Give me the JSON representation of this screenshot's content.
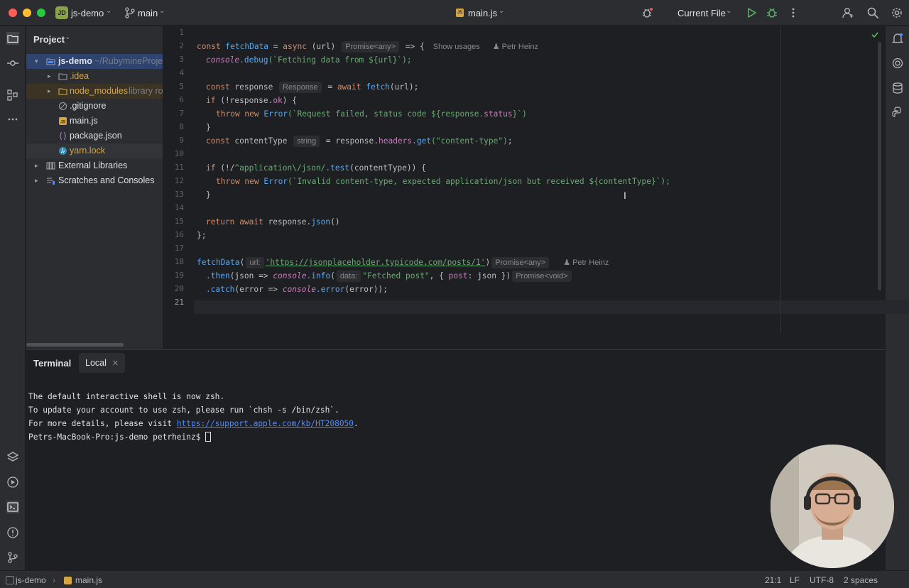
{
  "titlebar": {
    "project_badge": "JD",
    "project_name": "js-demo",
    "branch": "main",
    "file_name": "main.js",
    "run_config": "Current File"
  },
  "project_panel": {
    "header": "Project",
    "tree": [
      {
        "label": "js-demo",
        "suffix": "~/RubymineProject",
        "depth": 0,
        "type": "module",
        "expanded": true
      },
      {
        "label": ".idea",
        "suffix": "",
        "depth": 1,
        "type": "folder",
        "expanded": false
      },
      {
        "label": "node_modules",
        "suffix": "library ro",
        "depth": 1,
        "type": "folder-excluded",
        "expanded": false
      },
      {
        "label": ".gitignore",
        "suffix": "",
        "depth": 1,
        "type": "gitignore"
      },
      {
        "label": "main.js",
        "suffix": "",
        "depth": 1,
        "type": "js"
      },
      {
        "label": "package.json",
        "suffix": "",
        "depth": 1,
        "type": "json"
      },
      {
        "label": "yarn.lock",
        "suffix": "",
        "depth": 1,
        "type": "yarn"
      },
      {
        "label": "External Libraries",
        "suffix": "",
        "depth": 0,
        "type": "library",
        "expanded": false
      },
      {
        "label": "Scratches and Consoles",
        "suffix": "",
        "depth": 0,
        "type": "scratch",
        "expanded": false
      }
    ]
  },
  "editor": {
    "line_numbers": [
      "1",
      "2",
      "3",
      "4",
      "5",
      "6",
      "7",
      "8",
      "9",
      "10",
      "11",
      "12",
      "13",
      "14",
      "15",
      "16",
      "17",
      "18",
      "19",
      "20",
      "21"
    ],
    "hints": {
      "promise_any": "Promise<any>",
      "show_usages": "Show usages",
      "author": "Petr Heinz",
      "response_type": "Response",
      "string_type": "string",
      "url_param": "url:",
      "data_param": "data:",
      "promise_void": "Promise<void>"
    },
    "code": {
      "l2_a": "const ",
      "l2_fn": "fetchData",
      "l2_b": " = ",
      "l2_async": "async",
      "l2_c": " (url) ",
      "l2_d": " => {",
      "l3_obj": "console",
      "l3_m": ".debug",
      "l3_str": "(`Fetching data from ${url}`);",
      "l5_a": "const ",
      "l5_b": "response ",
      "l5_c": " = ",
      "l5_await": "await ",
      "l5_fetch": "fetch",
      "l5_d": "(url);",
      "l6_if": "if ",
      "l6_a": "(!response.",
      "l6_ok": "ok",
      "l6_b": ") {",
      "l7_throw": "throw new ",
      "l7_err": "Error",
      "l7_str": "(`Request failed, status code ${response.",
      "l7_prop": "status",
      "l7_end": "}`)",
      "l8": "}",
      "l9_a": "const ",
      "l9_b": "contentType ",
      "l9_c": " = response.",
      "l9_prop": "headers",
      "l9_get": ".get",
      "l9_str": "(\"content-type\")",
      "l9_end": ";",
      "l11_if": "if ",
      "l11_a": "(!/",
      "l11_re": "^application\\/json/",
      "l11_test": ".test",
      "l11_b": "(contentType)) {",
      "l12_throw": "throw new ",
      "l12_err": "Error",
      "l12_str": "(`Invalid content-type, expected application/json but received ${contentType}`);",
      "l13": "}",
      "l15_ret": "return await ",
      "l15_a": "response.",
      "l15_json": "json",
      "l15_b": "()",
      "l16": "};",
      "l18_fn": "fetchData",
      "l18_a": "(",
      "l18_url": "'https://jsonplaceholder.typicode.com/posts/1'",
      "l18_b": ")",
      "l19_a": ".then",
      "l19_b": "(json => ",
      "l19_obj": "console",
      "l19_m": ".info",
      "l19_c": "(",
      "l19_str": "\"Fetched post\"",
      "l19_d": ", { ",
      "l19_prop": "post",
      "l19_e": ": json })",
      "l20_a": ".catch",
      "l20_b": "(error => ",
      "l20_obj": "console",
      "l20_m": ".error",
      "l20_c": "(error));"
    }
  },
  "terminal": {
    "title": "Terminal",
    "tab": "Local",
    "lines": [
      "The default interactive shell is now zsh.",
      "To update your account to use zsh, please run `chsh -s /bin/zsh`."
    ],
    "line3_prefix": "For more details, please visit ",
    "line3_link": "https://support.apple.com/kb/HT208050",
    "line3_suffix": ".",
    "prompt": "Petrs-MacBook-Pro:js-demo petrheinz$ "
  },
  "statusbar": {
    "project": "js-demo",
    "file": "main.js",
    "position": "21:1",
    "line_sep": "LF",
    "encoding": "UTF-8",
    "indent": "2 spaces"
  },
  "colors": {
    "accent_green": "#5fb865",
    "keyword": "#cf8e6d",
    "function": "#56a8f5",
    "string": "#6aab73",
    "property": "#c77dbb"
  }
}
